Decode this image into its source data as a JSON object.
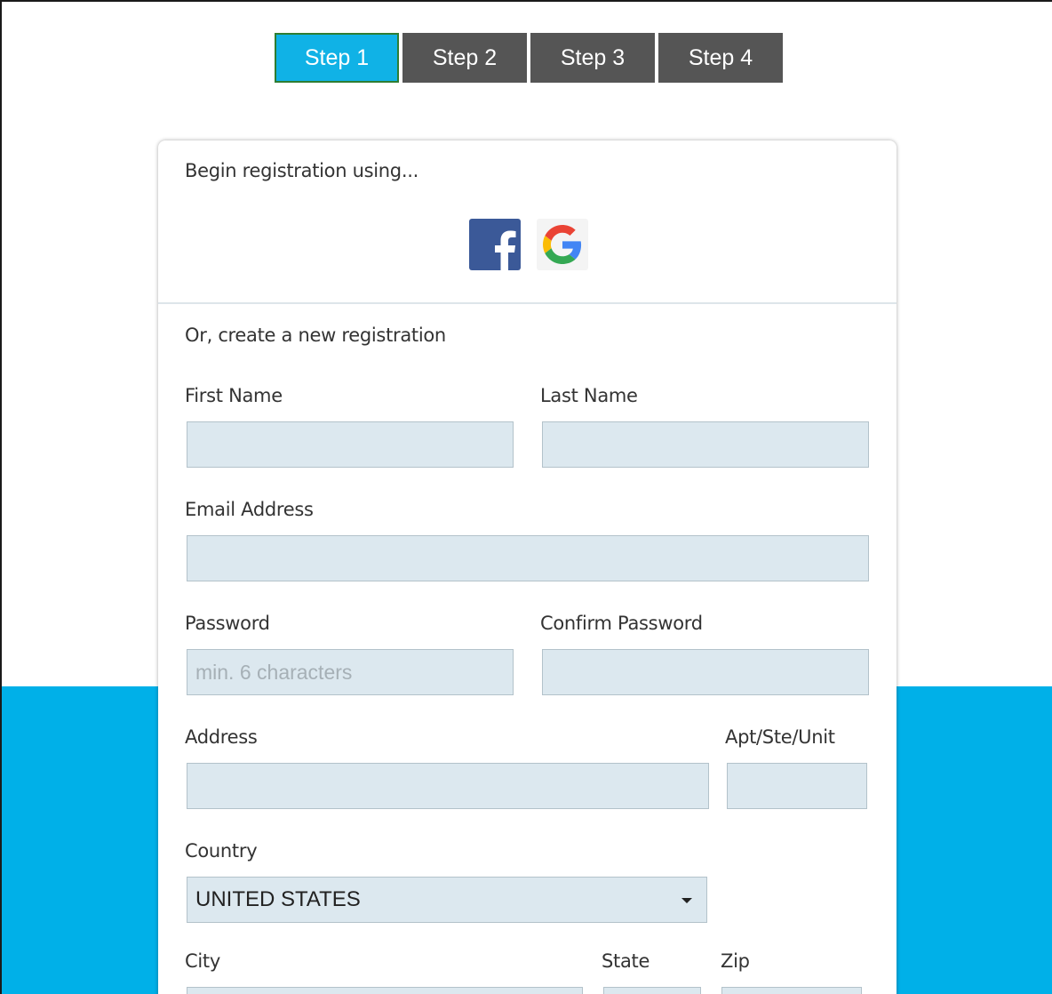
{
  "steps": [
    {
      "label": "Step 1",
      "active": true
    },
    {
      "label": "Step 2",
      "active": false
    },
    {
      "label": "Step 3",
      "active": false
    },
    {
      "label": "Step 4",
      "active": false
    }
  ],
  "social": {
    "heading": "Begin registration using..."
  },
  "form": {
    "heading": "Or, create a new registration",
    "first_name_label": "First Name",
    "last_name_label": "Last Name",
    "email_label": "Email Address",
    "password_label": "Password",
    "password_placeholder": "min. 6 characters",
    "confirm_password_label": "Confirm Password",
    "address_label": "Address",
    "apt_label": "Apt/Ste/Unit",
    "country_label": "Country",
    "country_value": "UNITED STATES",
    "city_label": "City",
    "state_label": "State",
    "zip_label": "Zip"
  },
  "colors": {
    "accent": "#00b0e8",
    "step_inactive": "#555555",
    "input_bg": "#dce8ef",
    "facebook": "#3b5998"
  }
}
